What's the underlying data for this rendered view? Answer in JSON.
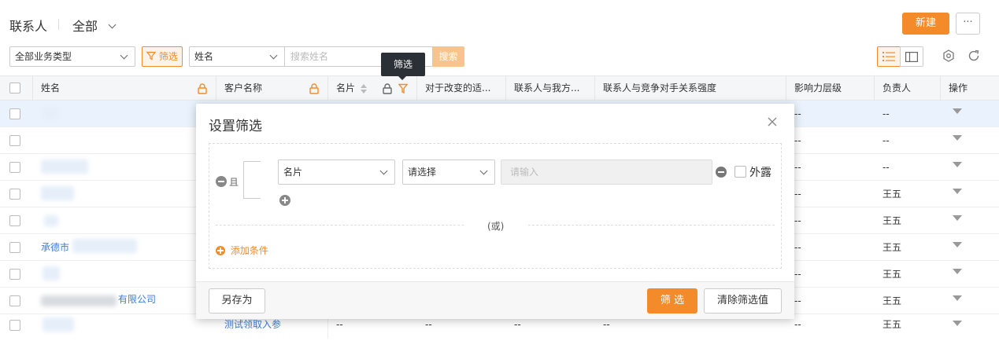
{
  "header": {
    "title": "联系人",
    "view": "全部",
    "new_button": "新建",
    "more_button": "···"
  },
  "filterbar": {
    "business_type": "全部业务类型",
    "filter_button": "筛选",
    "search_field": "姓名",
    "search_placeholder": "搜索姓名",
    "search_button": "搜索"
  },
  "tooltip": "筛选",
  "table": {
    "columns": [
      "姓名",
      "客户名称",
      "名片",
      "对于改变的适...",
      "联系人与我方...",
      "联系人与竞争对手关系强度",
      "影响力层级",
      "负责人",
      "操作"
    ],
    "rows": [
      {
        "name": "",
        "customer": "",
        "influence": "--",
        "owner": "--"
      },
      {
        "name": "",
        "customer": "",
        "influence": "--",
        "owner": "--"
      },
      {
        "name": "",
        "customer": "",
        "influence": "--",
        "owner": "--"
      },
      {
        "name": "",
        "customer": "",
        "influence": "--",
        "owner": "王五"
      },
      {
        "name": "",
        "customer": "",
        "influence": "--",
        "owner": "王五"
      },
      {
        "name": "承德市",
        "customer": "",
        "influence": "--",
        "owner": "王五"
      },
      {
        "name": "",
        "customer": "",
        "influence": "--",
        "owner": "王五"
      },
      {
        "name": "有限公司",
        "customer": "",
        "influence": "--",
        "owner": "王五"
      },
      {
        "name": "",
        "customer": "测试领取入参",
        "card": "--",
        "c4": "--",
        "c5": "--",
        "c6": "--",
        "influence": "--",
        "owner": "王五"
      }
    ]
  },
  "modal": {
    "title": "设置筛选",
    "and_label": "且",
    "field": "名片",
    "operator": "请选择",
    "value_placeholder": "请输入",
    "exposed_label": "外露",
    "or_label": "(或)",
    "add_condition": "添加条件",
    "save_as": "另存为",
    "apply": "筛 选",
    "clear": "清除筛选值"
  },
  "colors": {
    "accent": "#f48b2a",
    "link": "#3b7dd8",
    "row_highlight": "#eaf3fd"
  }
}
